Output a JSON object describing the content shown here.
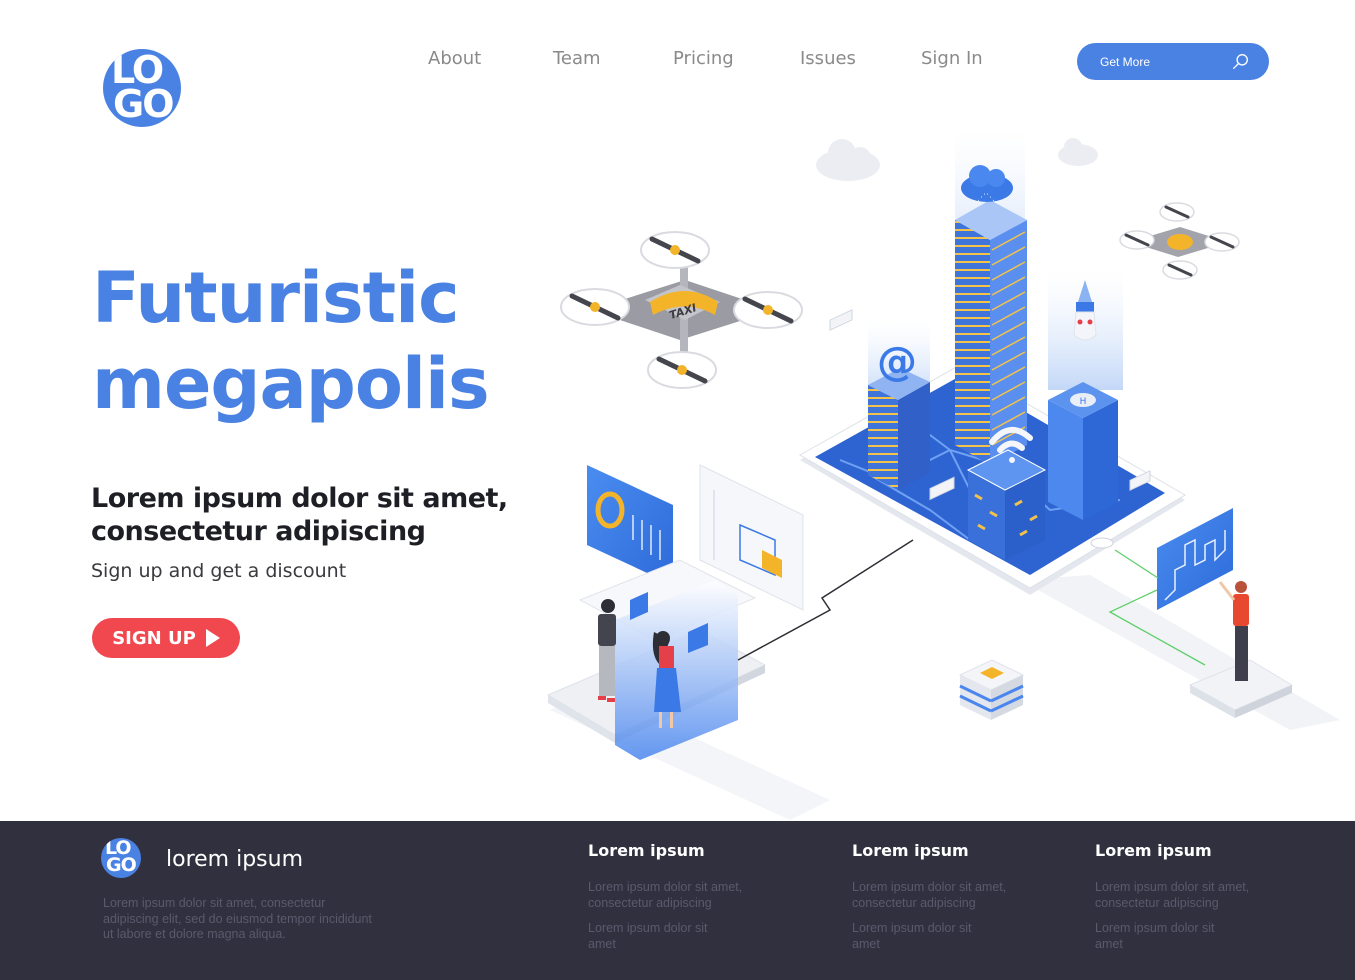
{
  "header": {
    "logo_text_top": "LO",
    "logo_text_bottom": "GO",
    "nav": [
      "About",
      "Team",
      "Pricing",
      "Issues",
      "Sign In"
    ],
    "cta_label": "Get More",
    "cta_icon": "search-icon"
  },
  "hero": {
    "title_line1": "Futuristic",
    "title_line2": "megapolis",
    "subtitle_line1": "Lorem ipsum dolor sit amet,",
    "subtitle_line2": "consectetur adipiscing",
    "tagline": "Sign up and get a discount",
    "signup_label": "SIGN UP",
    "signup_icon": "play-icon",
    "illustration_labels": {
      "drone_sign": "TAXI",
      "email_symbol": "@",
      "helipad_symbol": "H"
    }
  },
  "colors": {
    "brand_blue": "#4a82e3",
    "signup_red": "#f1474f",
    "footer_bg": "#31303f",
    "nav_gray": "#8a8a8a"
  },
  "footer": {
    "logo_text_top": "LO",
    "logo_text_bottom": "GO",
    "brand": "lorem ipsum",
    "description": "Lorem ipsum dolor sit amet, consectetur adipiscing elit, sed do eiusmod tempor incididunt ut labore et dolore magna aliqua.",
    "columns": [
      {
        "title": "Lorem ipsum",
        "items": [
          "Lorem ipsum dolor sit amet, consectetur adipiscing",
          "Lorem ipsum dolor sit amet"
        ]
      },
      {
        "title": "Lorem ipsum",
        "items": [
          "Lorem ipsum dolor sit amet, consectetur adipiscing",
          "Lorem ipsum dolor sit amet"
        ]
      },
      {
        "title": "Lorem ipsum",
        "items": [
          "Lorem ipsum dolor sit amet, consectetur adipiscing",
          "Lorem ipsum dolor sit amet"
        ]
      }
    ]
  }
}
